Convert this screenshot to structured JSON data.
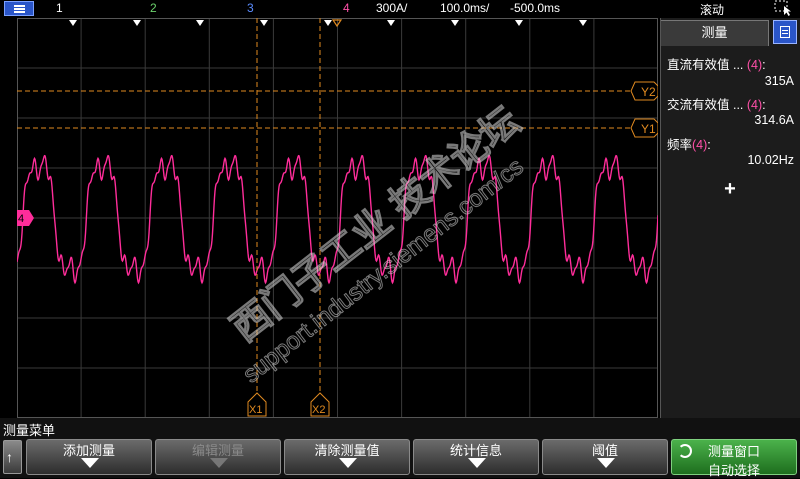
{
  "topbar": {
    "ch1": "1",
    "ch2": "2",
    "ch3": "3",
    "ch4": "4",
    "vdiv": "300A/",
    "tdiv": "100.0ms/",
    "tpos": "-500.0ms",
    "mode": "滚动"
  },
  "colors": {
    "trace": "#ff2d9a",
    "cursor": "#e08a20",
    "grid": "#3a3a3a",
    "accent_blue": "#2a55c8",
    "softkey_green": "#3aa03a"
  },
  "cursors": {
    "x1": "X1",
    "x2": "X2",
    "y1": "Y1",
    "y2": "Y2"
  },
  "channel_marker": "4",
  "side": {
    "title": "测量",
    "measurements": [
      {
        "label": "直流有效值 ... ",
        "channel": "(4)",
        "suffix": ":",
        "value": "315A"
      },
      {
        "label": "交流有效值 ... ",
        "channel": "(4)",
        "suffix": ":",
        "value": "314.6A"
      },
      {
        "label": "频率",
        "channel": "(4)",
        "suffix": ":",
        "value": "10.02Hz"
      }
    ],
    "add_icon": "plus-icon"
  },
  "watermark": {
    "line1": "西门子工业 技术论坛",
    "line2": "support.industry.siemens.com/cs"
  },
  "footer": {
    "title": "测量菜单",
    "softkeys": [
      {
        "label": "添加测量"
      },
      {
        "label": "编辑测量"
      },
      {
        "label": "清除测量值"
      },
      {
        "label": "统计信息"
      },
      {
        "label": "阈值"
      },
      {
        "label1": "测量窗口",
        "label2": "自动选择"
      }
    ]
  }
}
